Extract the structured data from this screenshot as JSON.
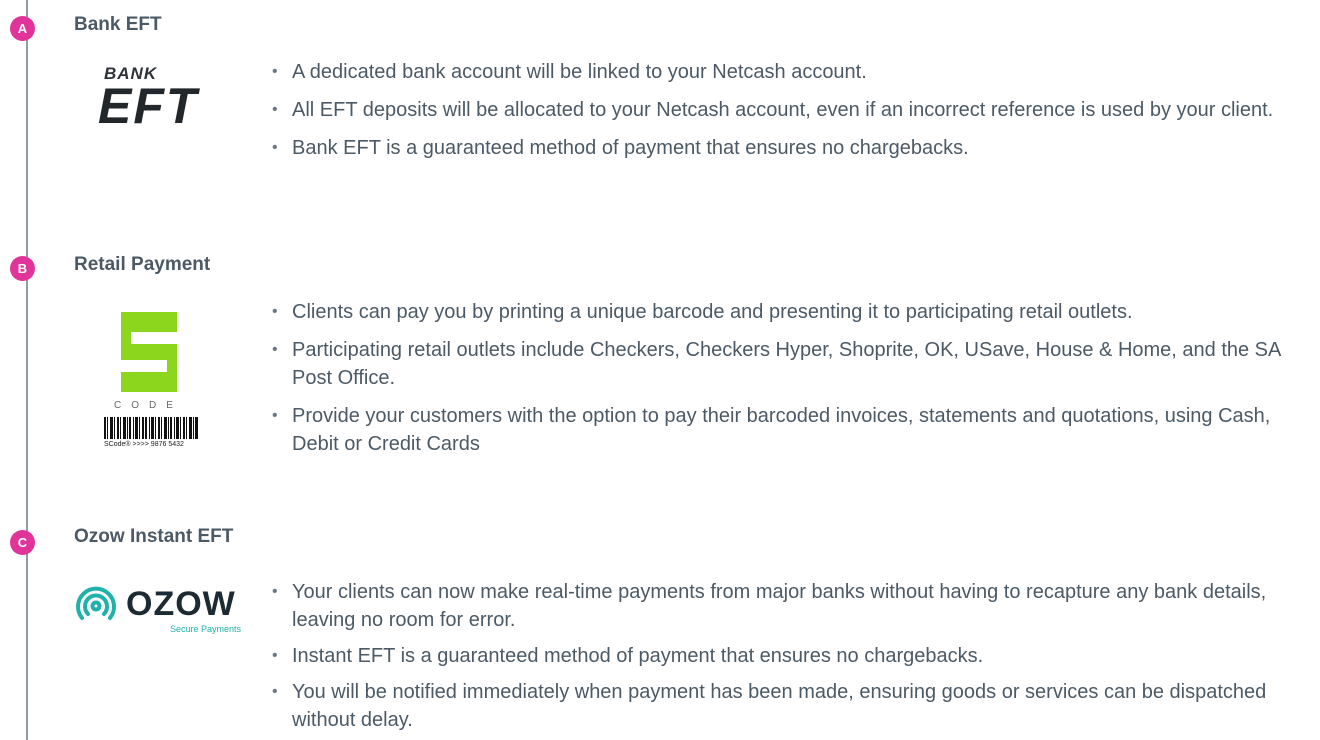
{
  "colors": {
    "marker": "#e0349a",
    "text": "#4b5a66",
    "scode_green": "#8cd61e",
    "ozow_teal": "#1eb2a8",
    "timeline": "#8f9aa3"
  },
  "sections": [
    {
      "marker": "A",
      "title": "Bank EFT",
      "logo": {
        "top_text": "BANK",
        "main_text": "EFT"
      },
      "bullets": [
        "A dedicated bank account will be linked to your Netcash account.",
        "All EFT deposits will be allocated to your Netcash account, even if an incorrect reference is used by your client.",
        "Bank EFT is a guaranteed method of payment that ensures no chargebacks."
      ]
    },
    {
      "marker": "B",
      "title": "Retail Payment",
      "logo": {
        "letters": "CODE",
        "caption": "SCode® >>>> 9876 5432"
      },
      "bullets": [
        "Clients can pay you by printing a unique barcode and presenting it to participating retail outlets.",
        "Participating retail outlets include Checkers, Checkers Hyper, Shoprite, OK, USave, House & Home, and the SA Post Office.",
        "Provide your customers with the option to pay their barcoded invoices, statements and quotations, using Cash, Debit or Credit Cards"
      ]
    },
    {
      "marker": "C",
      "title": "Ozow Instant EFT",
      "logo": {
        "word": "OZOW",
        "sub": "Secure Payments"
      },
      "bullets": [
        "Your clients can now make real-time payments from major banks without having to recapture any bank details, leaving no room for error.",
        "Instant EFT is a guaranteed method of payment that ensures no chargebacks.",
        "You will be notified immediately when payment has been made, ensuring goods or services can be dispatched without delay."
      ]
    }
  ]
}
